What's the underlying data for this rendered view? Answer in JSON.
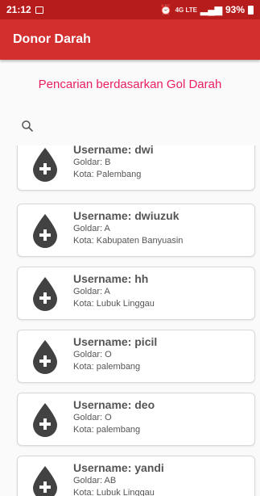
{
  "status": {
    "time": "21:12",
    "signal_text": "4G LTE",
    "battery": "93%"
  },
  "app": {
    "title": "Donor Darah"
  },
  "heading": "Pencarian berdasarkan Gol Darah",
  "search": {
    "icon": "search-icon",
    "value": ""
  },
  "donors": [
    {
      "username": "Username: dwi",
      "goldar": "Goldar: B",
      "kota": "Kota: Palembang"
    },
    {
      "username": "Username: dwiuzuk",
      "goldar": "Goldar: A",
      "kota": "Kota: Kabupaten Banyuasin"
    },
    {
      "username": "Username: hh",
      "goldar": "Goldar: A",
      "kota": "Kota: Lubuk Linggau"
    },
    {
      "username": "Username: picil",
      "goldar": "Goldar: O",
      "kota": "Kota: palembang"
    },
    {
      "username": "Username: deo",
      "goldar": "Goldar: O",
      "kota": "Kota: palembang"
    },
    {
      "username": "Username: yandi",
      "goldar": "Goldar: AB",
      "kota": "Kota: Lubuk Linggau"
    }
  ],
  "colors": {
    "statusbar": "#b71c1c",
    "appbar": "#d32f2f",
    "heading": "#e91e63",
    "drop_icon": "#424242"
  }
}
